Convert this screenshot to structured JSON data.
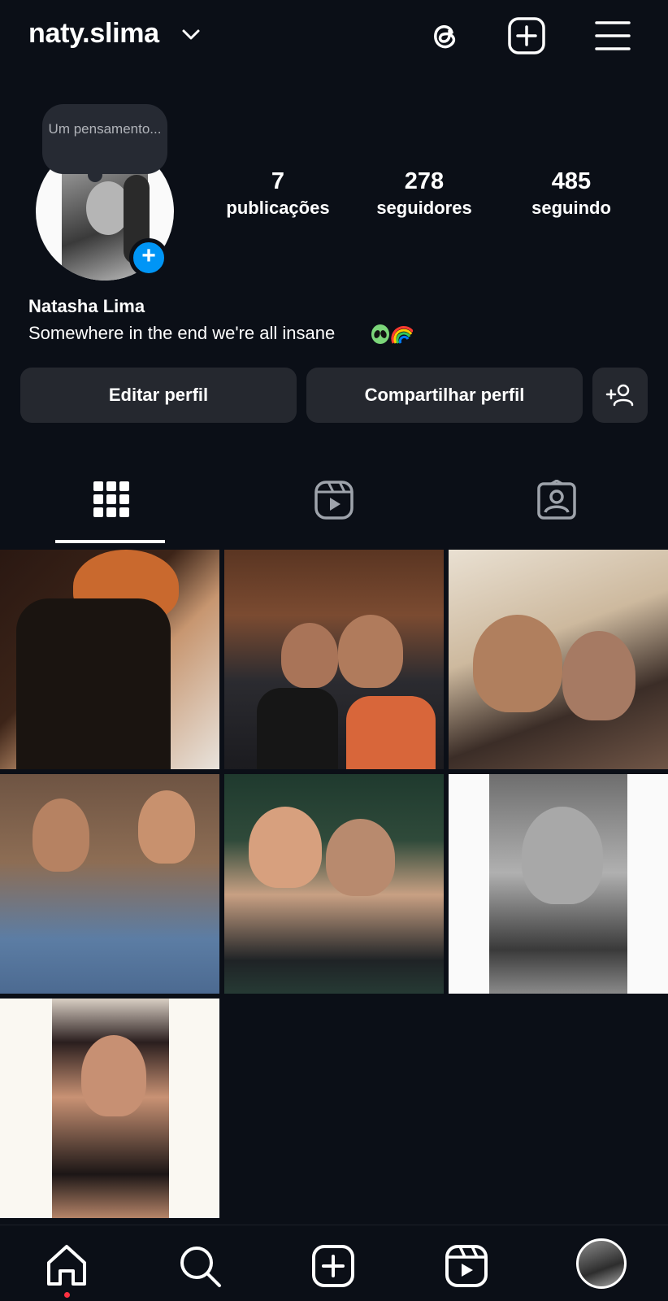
{
  "header": {
    "username": "naty.slima",
    "icons": [
      "chevron-down-icon",
      "threads-icon",
      "new-post-icon",
      "menu-icon"
    ]
  },
  "profile": {
    "note": "Um pensamento...",
    "stats": [
      {
        "value": "7",
        "label": "publicações"
      },
      {
        "value": "278",
        "label": "seguidores"
      },
      {
        "value": "485",
        "label": "seguindo"
      }
    ],
    "full_name": "Natasha Lima",
    "bio": "Somewhere in the end we're all insane"
  },
  "actions": {
    "edit": "Editar perfil",
    "share": "Compartilhar perfil"
  },
  "tabs": [
    "grid-icon",
    "reels-icon",
    "tagged-icon"
  ],
  "active_tab": "grid",
  "posts_count": 7,
  "nav": [
    "home-icon",
    "search-icon",
    "create-icon",
    "reels-icon",
    "profile-avatar"
  ],
  "colors": {
    "background": "#0b0f17",
    "button": "#25282f",
    "accent": "#0095f6",
    "notification": "#ff3040"
  }
}
